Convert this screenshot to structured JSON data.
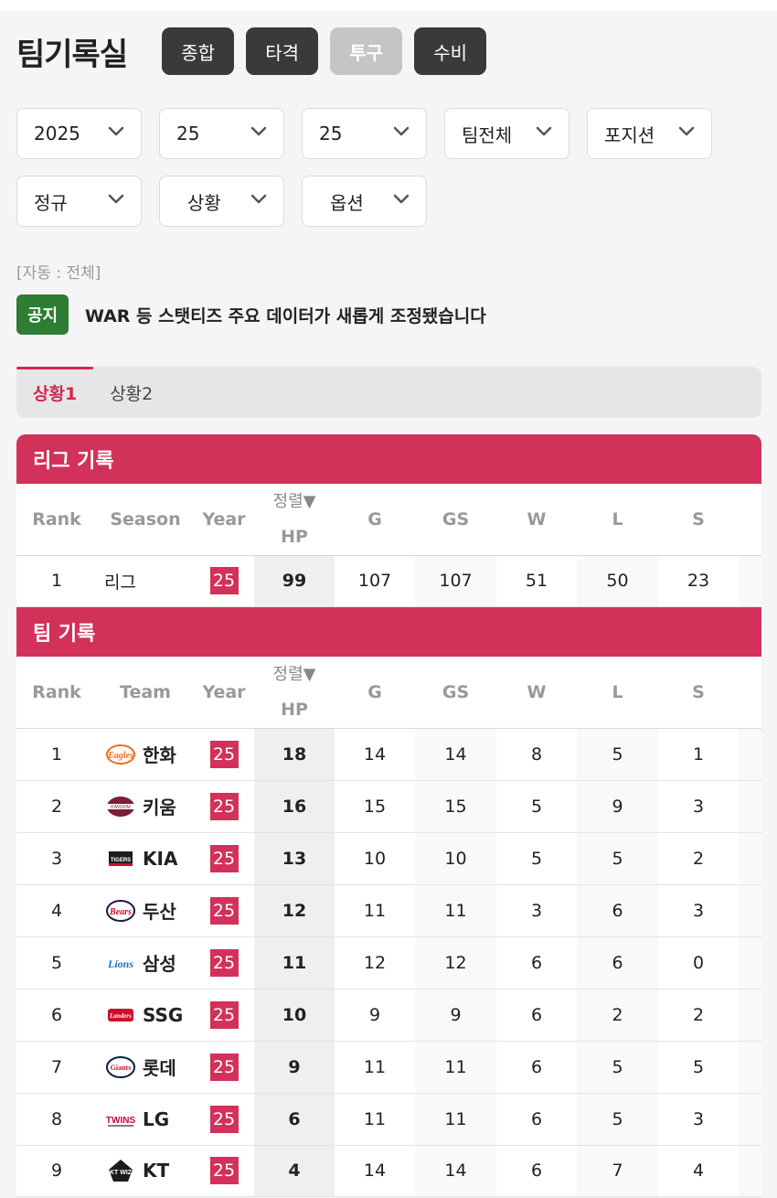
{
  "page_title": "팀기록실",
  "categories": [
    {
      "label": "종합",
      "active": false
    },
    {
      "label": "타격",
      "active": false
    },
    {
      "label": "투구",
      "active": true
    },
    {
      "label": "수비",
      "active": false
    }
  ],
  "filters": {
    "row1": [
      "2025",
      "25",
      "25",
      "팀전체",
      "포지션"
    ],
    "row2": [
      "정규",
      "상황",
      "옵션"
    ]
  },
  "auto_note": "[자동 : 전체]",
  "notice": {
    "badge": "공지",
    "text": "WAR 등 스탯티즈 주요 데이터가 새롭게 조정됐습니다"
  },
  "subtabs": [
    {
      "label": "상황1",
      "active": true
    },
    {
      "label": "상황2",
      "active": false
    }
  ],
  "league_section": {
    "title": "리그 기록",
    "headers": [
      "Rank",
      "Season",
      "Year",
      "HP",
      "G",
      "GS",
      "W",
      "L",
      "S"
    ],
    "sort_label": "정렬▼",
    "row": {
      "rank": "1",
      "season": "리그",
      "year": "25",
      "hp": "99",
      "g": "107",
      "gs": "107",
      "w": "51",
      "l": "50",
      "s": "23"
    }
  },
  "team_section": {
    "title": "팀 기록",
    "headers": [
      "Rank",
      "Team",
      "Year",
      "HP",
      "G",
      "GS",
      "W",
      "L",
      "S"
    ],
    "sort_label": "정렬▼",
    "rows": [
      {
        "rank": "1",
        "team": "한화",
        "logo": "eagles-logo",
        "year": "25",
        "hp": "18",
        "g": "14",
        "gs": "14",
        "w": "8",
        "l": "5",
        "s": "1"
      },
      {
        "rank": "2",
        "team": "키움",
        "logo": "heroes-logo",
        "year": "25",
        "hp": "16",
        "g": "15",
        "gs": "15",
        "w": "5",
        "l": "9",
        "s": "3"
      },
      {
        "rank": "3",
        "team": "KIA",
        "logo": "tigers-logo",
        "year": "25",
        "hp": "13",
        "g": "10",
        "gs": "10",
        "w": "5",
        "l": "5",
        "s": "2"
      },
      {
        "rank": "4",
        "team": "두산",
        "logo": "bears-logo",
        "year": "25",
        "hp": "12",
        "g": "11",
        "gs": "11",
        "w": "3",
        "l": "6",
        "s": "3"
      },
      {
        "rank": "5",
        "team": "삼성",
        "logo": "lions-logo",
        "year": "25",
        "hp": "11",
        "g": "12",
        "gs": "12",
        "w": "6",
        "l": "6",
        "s": "0"
      },
      {
        "rank": "6",
        "team": "SSG",
        "logo": "landers-logo",
        "year": "25",
        "hp": "10",
        "g": "9",
        "gs": "9",
        "w": "6",
        "l": "2",
        "s": "2"
      },
      {
        "rank": "7",
        "team": "롯데",
        "logo": "giants-logo",
        "year": "25",
        "hp": "9",
        "g": "11",
        "gs": "11",
        "w": "6",
        "l": "5",
        "s": "5"
      },
      {
        "rank": "8",
        "team": "LG",
        "logo": "twins-logo",
        "year": "25",
        "hp": "6",
        "g": "11",
        "gs": "11",
        "w": "6",
        "l": "5",
        "s": "3"
      },
      {
        "rank": "9",
        "team": "KT",
        "logo": "wiz-logo",
        "year": "25",
        "hp": "4",
        "g": "14",
        "gs": "14",
        "w": "6",
        "l": "7",
        "s": "4"
      }
    ]
  },
  "colors": {
    "accent": "#d2315a",
    "notice_green": "#2e7d32",
    "dark_button": "#3a3a3c"
  }
}
